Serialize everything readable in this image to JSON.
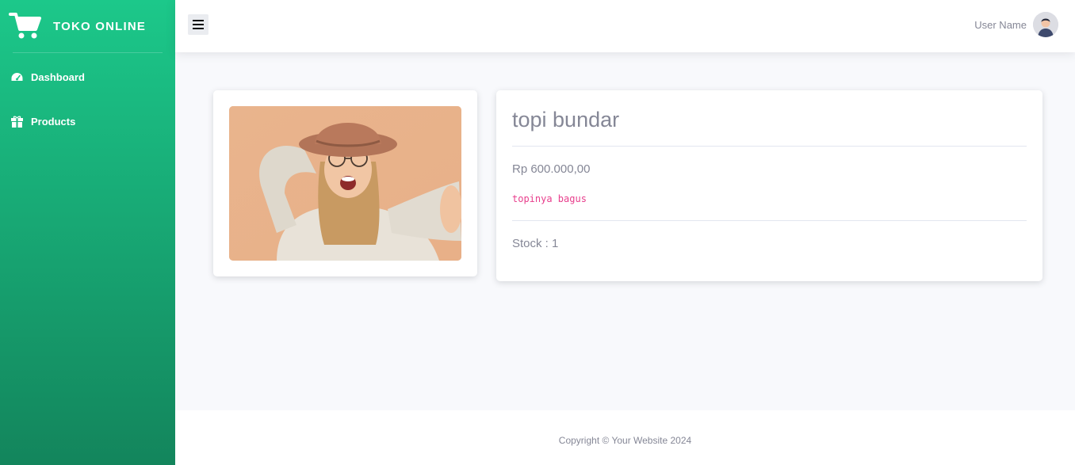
{
  "brand": {
    "name": "TOKO ONLINE",
    "icon": "shopping-cart-icon"
  },
  "sidebar": {
    "items": [
      {
        "label": "Dashboard",
        "icon": "tachometer-icon"
      },
      {
        "label": "Products",
        "icon": "box-icon"
      }
    ]
  },
  "topbar": {
    "toggle_icon": "hamburger-icon",
    "user_name": "User Name"
  },
  "product": {
    "title": "topi bundar",
    "price": "Rp 600.000,00",
    "description": "topinya bagus",
    "stock": "Stock : 1"
  },
  "footer": {
    "copyright": "Copyright © Your Website 2024"
  },
  "colors": {
    "sidebar_top": "#1cc88a",
    "sidebar_bottom": "#13855c",
    "text_muted": "#858796",
    "code_pink": "#e83e8c"
  }
}
